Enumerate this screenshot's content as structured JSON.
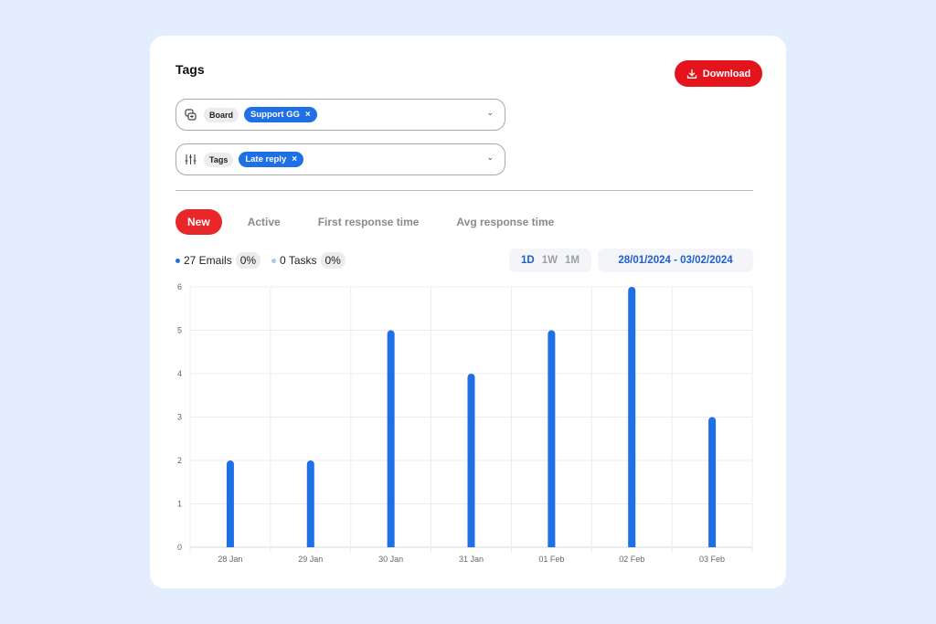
{
  "header": {
    "title": "Tags",
    "download_label": "Download",
    "download_icon": "download-icon"
  },
  "filters": [
    {
      "icon": "board-icon",
      "label": "Board",
      "value": "Support GG"
    },
    {
      "icon": "sliders-icon",
      "label": "Tags",
      "value": "Late reply"
    }
  ],
  "tabs": [
    {
      "label": "New",
      "active": true
    },
    {
      "label": "Active",
      "active": false
    },
    {
      "label": "First response time",
      "active": false
    },
    {
      "label": "Avg response time",
      "active": false
    }
  ],
  "legend": [
    {
      "label": "27 Emails",
      "pct": "0%",
      "color": "#1f6fe5"
    },
    {
      "label": "0 Tasks",
      "pct": "0%",
      "color": "#a9c8f5"
    }
  ],
  "ranges": [
    {
      "label": "1D",
      "selected": true
    },
    {
      "label": "1W",
      "selected": false
    },
    {
      "label": "1M",
      "selected": false
    }
  ],
  "date_range": "28/01/2024 - 03/02/2024",
  "colors": {
    "accent": "#e3141b",
    "primary": "#1f6fe5"
  },
  "chart_data": {
    "type": "bar",
    "title": "",
    "xlabel": "",
    "ylabel": "",
    "categories": [
      "28 Jan",
      "29 Jan",
      "30 Jan",
      "31 Jan",
      "01 Feb",
      "02 Feb",
      "03 Feb"
    ],
    "series": [
      {
        "name": "Emails",
        "values": [
          2,
          2,
          5,
          4,
          5,
          6,
          3
        ],
        "color": "#1f6fe5"
      }
    ],
    "ylim": [
      0,
      6
    ],
    "yticks": [
      0,
      1,
      2,
      3,
      4,
      5,
      6
    ],
    "grid": true,
    "legend": "top-left"
  }
}
